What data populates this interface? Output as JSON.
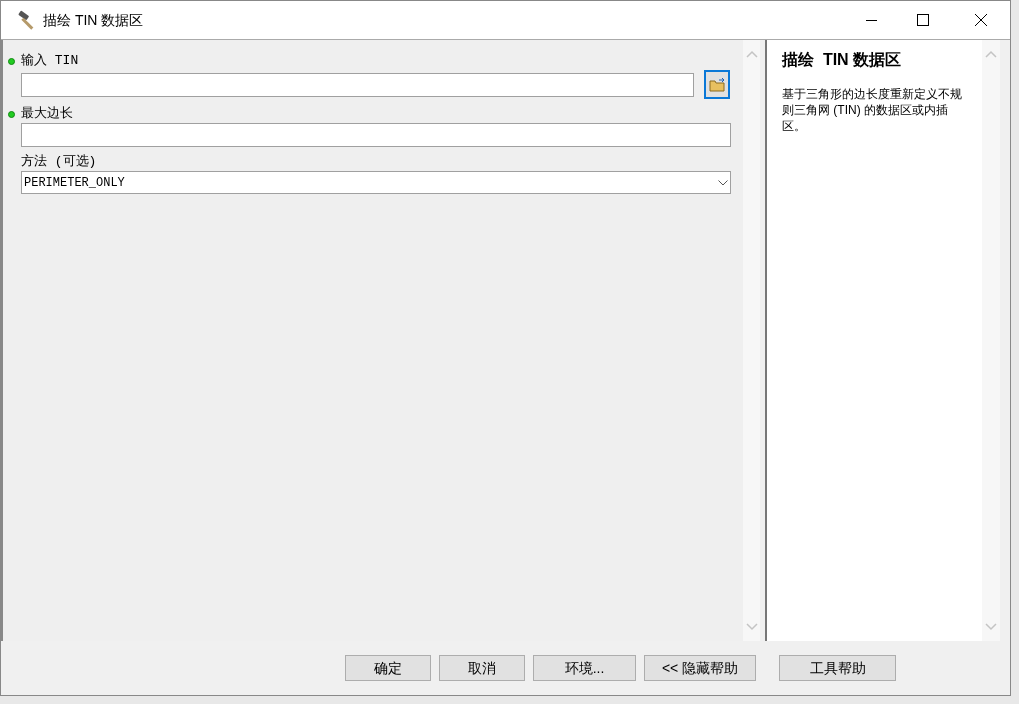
{
  "window": {
    "title": "描绘 TIN 数据区"
  },
  "parameters": [
    {
      "label": "输入 TIN",
      "required": true,
      "kind": "file"
    },
    {
      "label": "最大边长",
      "required": true,
      "kind": "text"
    },
    {
      "label": "方法 (可选)",
      "required": false,
      "kind": "dropdown",
      "value": "PERIMETER_ONLY"
    }
  ],
  "help": {
    "title": "描绘  TIN 数据区",
    "text": "基于三角形的边长度重新定义不规则三角网 (TIN) 的数据区或内插区。"
  },
  "buttons": [
    "确定",
    "取消",
    "环境...",
    "<< 隐藏帮助",
    "工具帮助"
  ]
}
